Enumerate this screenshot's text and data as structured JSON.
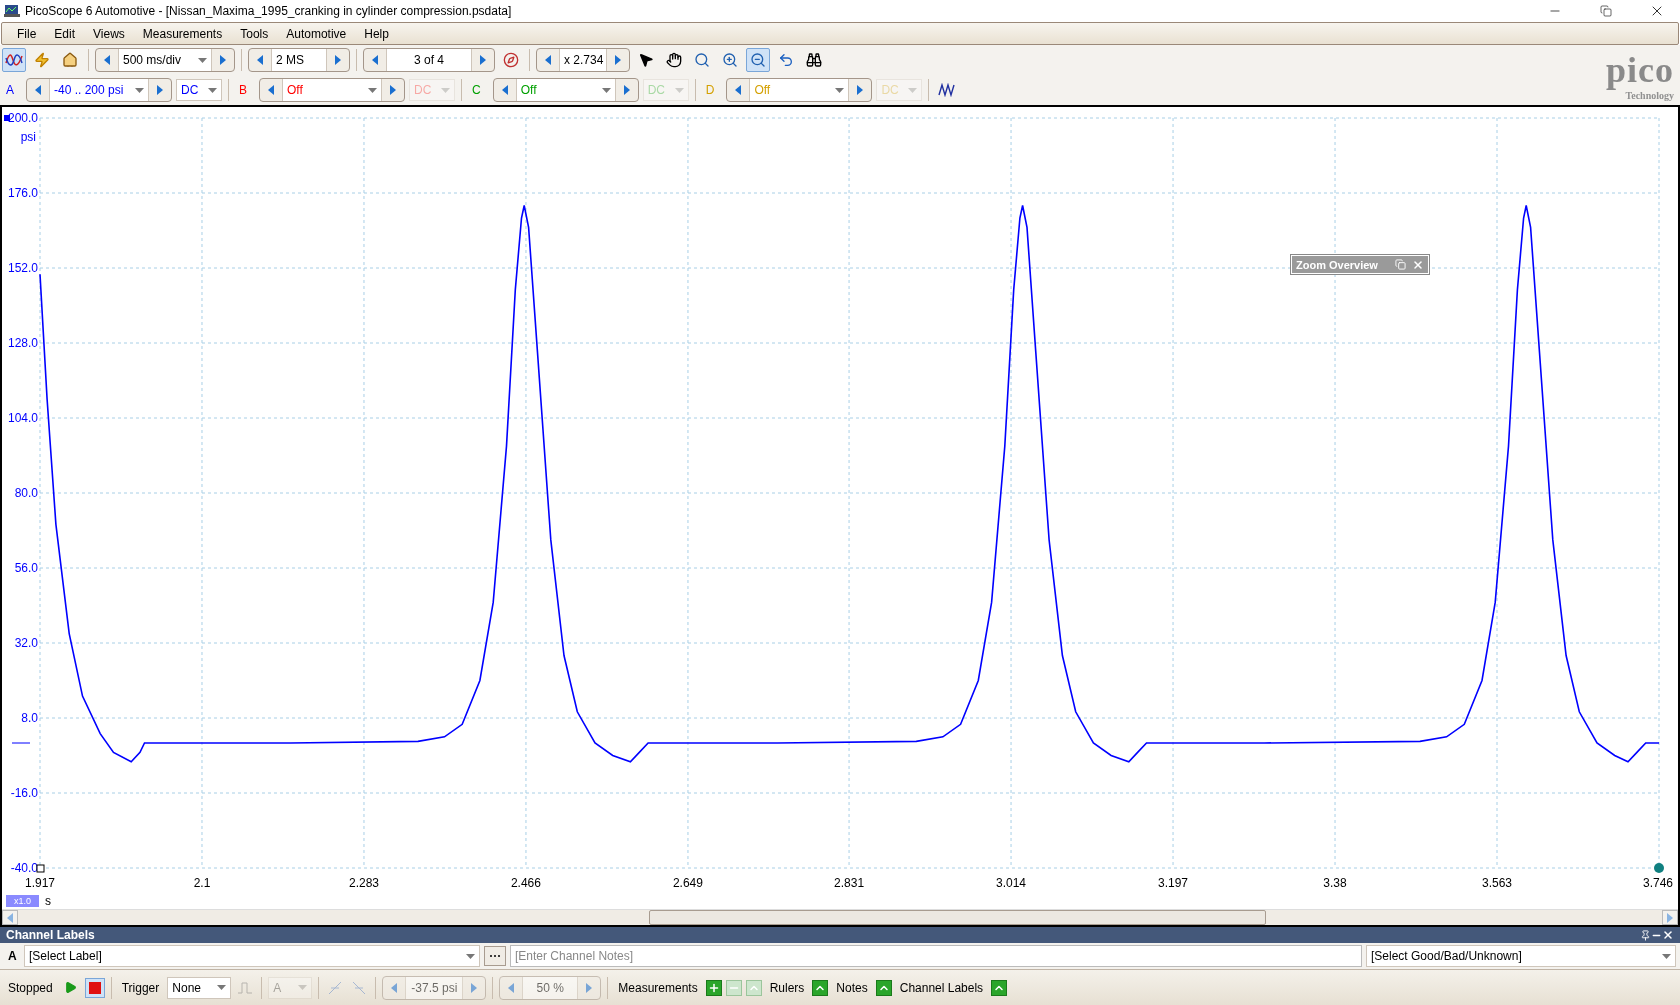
{
  "window": {
    "title": "PicoScope 6 Automotive - [Nissan_Maxima_1995_cranking in cylinder compression.psdata]"
  },
  "menu": [
    "File",
    "Edit",
    "Views",
    "Measurements",
    "Tools",
    "Automotive",
    "Help"
  ],
  "mode_buttons": [
    {
      "kind": "scope",
      "selected": true
    },
    {
      "kind": "auto_setup",
      "selected": false
    },
    {
      "kind": "home",
      "selected": false
    }
  ],
  "timebase": "500 ms/div",
  "samples": "2 MS",
  "buffer": "3 of 4",
  "zoom": "x 2.734",
  "tools": [
    {
      "kind": "pointer",
      "selected": false
    },
    {
      "kind": "hand",
      "selected": false
    },
    {
      "kind": "zoom",
      "selected": false
    },
    {
      "kind": "zoom_in",
      "selected": false
    },
    {
      "kind": "zoom_out",
      "selected": true
    },
    {
      "kind": "undo",
      "selected": false
    },
    {
      "kind": "overview",
      "selected": false
    }
  ],
  "logo": {
    "name": "pico",
    "tagline": "Technology"
  },
  "channels": [
    {
      "letter": "A",
      "range": "-40 .. 200 psi",
      "coupling": "DC",
      "enabled": true,
      "color": "#0000ff"
    },
    {
      "letter": "B",
      "range": "Off",
      "coupling": "DC",
      "enabled": false,
      "color": "#ff0000"
    },
    {
      "letter": "C",
      "range": "Off",
      "coupling": "DC",
      "enabled": false,
      "color": "#00a000"
    },
    {
      "letter": "D",
      "range": "Off",
      "coupling": "DC",
      "enabled": false,
      "color": "#d4a000"
    }
  ],
  "chart": {
    "y_unit": "psi",
    "x_unit": "s",
    "zoom_badge": "x1.0",
    "chart_data": {
      "type": "line",
      "xlim": [
        1.917,
        3.746
      ],
      "ylim": [
        -40,
        200
      ],
      "xticks": [
        {
          "value": 1.917,
          "label": "1.917"
        },
        {
          "value": 2.1,
          "label": "2.1"
        },
        {
          "value": 2.283,
          "label": "2.283"
        },
        {
          "value": 2.466,
          "label": "2.466"
        },
        {
          "value": 2.649,
          "label": "2.649"
        },
        {
          "value": 2.831,
          "label": "2.831"
        },
        {
          "value": 3.014,
          "label": "3.014"
        },
        {
          "value": 3.197,
          "label": "3.197"
        },
        {
          "value": 3.38,
          "label": "3.38"
        },
        {
          "value": 3.563,
          "label": "3.563"
        },
        {
          "value": 3.746,
          "label": "3.746"
        }
      ],
      "yticks": [
        {
          "value": 200,
          "label": "200.0"
        },
        {
          "value": 176,
          "label": "176.0"
        },
        {
          "value": 152,
          "label": "152.0"
        },
        {
          "value": 128,
          "label": "128.0"
        },
        {
          "value": 104,
          "label": "104.0"
        },
        {
          "value": 80,
          "label": "80.0"
        },
        {
          "value": 56,
          "label": "56.0"
        },
        {
          "value": 32,
          "label": "32.0"
        },
        {
          "value": 8,
          "label": "8.0"
        },
        {
          "value": -16,
          "label": "-16.0"
        },
        {
          "value": -40,
          "label": "-40.0"
        }
      ],
      "x": [
        1.917,
        1.925,
        1.935,
        1.95,
        1.965,
        1.985,
        2.0,
        2.02,
        2.03,
        2.035,
        2.2,
        2.344,
        2.374,
        2.394,
        2.414,
        2.429,
        2.444,
        2.454,
        2.461,
        2.464,
        2.469,
        2.479,
        2.494,
        2.509,
        2.524,
        2.544,
        2.564,
        2.584,
        2.594,
        2.604,
        2.75,
        2.907,
        2.937,
        2.957,
        2.977,
        2.992,
        3.007,
        3.017,
        3.024,
        3.027,
        3.032,
        3.042,
        3.057,
        3.072,
        3.087,
        3.107,
        3.127,
        3.147,
        3.157,
        3.167,
        3.3,
        3.476,
        3.506,
        3.526,
        3.546,
        3.561,
        3.576,
        3.586,
        3.593,
        3.596,
        3.601,
        3.611,
        3.626,
        3.641,
        3.656,
        3.676,
        3.696,
        3.711,
        3.721,
        3.731,
        3.746
      ],
      "grid": true,
      "series": [
        {
          "color": "#0000ff",
          "values": [
            150,
            110,
            70,
            35,
            15,
            3,
            -3,
            -6,
            -3,
            0,
            0,
            0.5,
            2,
            6,
            20,
            45,
            95,
            145,
            168,
            172,
            165,
            125,
            65,
            28,
            10,
            0,
            -4,
            -6,
            -3,
            0,
            0,
            0.5,
            2,
            6,
            20,
            45,
            95,
            145,
            168,
            172,
            165,
            125,
            65,
            28,
            10,
            0,
            -4,
            -6,
            -3,
            0,
            0,
            0.5,
            2,
            6,
            20,
            45,
            95,
            145,
            168,
            172,
            165,
            125,
            65,
            28,
            10,
            0,
            -4,
            -6,
            -3,
            0,
            0
          ]
        }
      ]
    }
  },
  "zoom_overview": {
    "title": "Zoom Overview"
  },
  "channel_labels": {
    "title": "Channel Labels",
    "channel": "A",
    "label": "[Select Label]",
    "notes_placeholder": "[Enter Channel Notes]",
    "rating": "[Select Good/Bad/Unknown]"
  },
  "status_bar": {
    "state": "Stopped",
    "running": false,
    "trigger_label": "Trigger",
    "trigger_mode": "None",
    "trigger_channel": {
      "value": "A",
      "disabled": true
    },
    "threshold": {
      "value": "-37.5 psi",
      "disabled": true
    },
    "pre_trigger": {
      "value": "50 %",
      "disabled": true
    },
    "panels": [
      {
        "label": "Measurements",
        "buttons": [
          {
            "kind": "add",
            "disabled": false
          },
          {
            "kind": "remove",
            "disabled": true
          },
          {
            "kind": "expand",
            "disabled": true
          }
        ]
      },
      {
        "label": "Rulers",
        "buttons": [
          {
            "kind": "expand",
            "disabled": false
          }
        ]
      },
      {
        "label": "Notes",
        "buttons": [
          {
            "kind": "expand",
            "disabled": false
          }
        ]
      },
      {
        "label": "Channel Labels",
        "buttons": [
          {
            "kind": "expand",
            "disabled": false
          }
        ]
      }
    ]
  }
}
